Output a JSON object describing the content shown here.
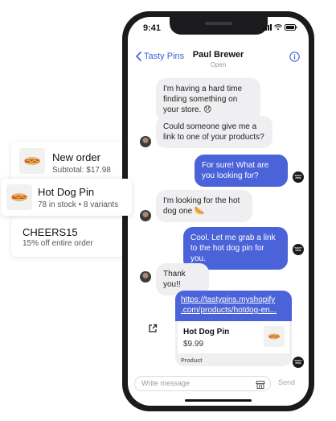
{
  "side_cards": {
    "order": {
      "title": "New order",
      "subtitle": "Subtotal: $17.98"
    },
    "product": {
      "title": "Hot Dog Pin",
      "subtitle": "78 in stock • 8 variants"
    },
    "discount": {
      "title": "CHEERS15",
      "subtitle": "15% off entire order"
    }
  },
  "status_bar": {
    "time": "9:41"
  },
  "header": {
    "back_label": "Tasty Pins",
    "contact_name": "Paul Brewer",
    "contact_status": "Open"
  },
  "messages": [
    {
      "from": "customer",
      "text": "I'm having a hard time finding something on your store. 😞"
    },
    {
      "from": "customer",
      "text": "Could someone give me a link to one of your products?"
    },
    {
      "from": "store",
      "text": "For sure! What are you looking for?"
    },
    {
      "from": "customer",
      "text": "I'm looking for the hot dog one 🌭"
    },
    {
      "from": "store",
      "text": "Cool. Let me grab a link to the hot dog pin for you."
    },
    {
      "from": "customer",
      "text": "Thank you!!"
    }
  ],
  "link_card": {
    "url_line1": "https://tastypins.myshopify",
    "url_line2": ".com/products/hotdog-en...",
    "product_name": "Hot Dog Pin",
    "price": "$9.99",
    "footer": "Product"
  },
  "composer": {
    "placeholder": "Write message",
    "send_label": "Send"
  },
  "colors": {
    "accent": "#4a63d9",
    "link": "#3a64d6",
    "incoming_bubble": "#efeff1"
  },
  "icons": [
    "back-chevron",
    "info-circle",
    "external-link",
    "store",
    "hot-dog-pin"
  ]
}
